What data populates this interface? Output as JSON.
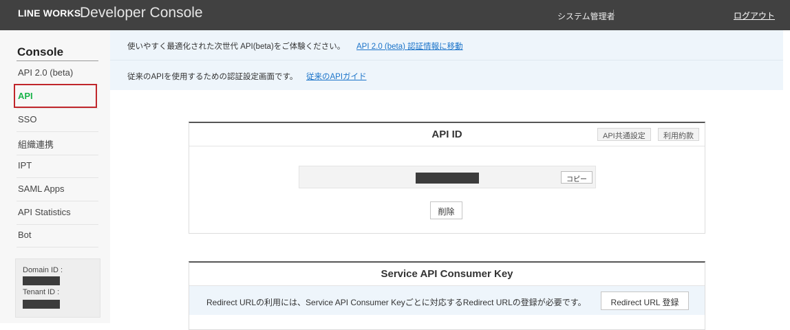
{
  "header": {
    "brand": "LINE WORKS",
    "product": "Developer Console",
    "user_role": "システム管理者",
    "logout_label": "ログアウト"
  },
  "sidebar": {
    "title": "Console",
    "items": [
      {
        "label": "API 2.0 (beta)"
      },
      {
        "label": "API",
        "active": true
      },
      {
        "label": "SSO"
      },
      {
        "label": "組織連携"
      },
      {
        "label": "IPT"
      },
      {
        "label": "SAML Apps"
      },
      {
        "label": "API Statistics"
      },
      {
        "label": "Bot"
      }
    ],
    "domain_id_label": "Domain ID :",
    "tenant_id_label": "Tenant ID :"
  },
  "notices": [
    {
      "text": "使いやすく最適化された次世代 API(beta)をご体験ください。",
      "link": "API 2.0 (beta) 認証情報に移動"
    },
    {
      "text": "従来のAPIを使用するための認証設定画面です。",
      "link": "従来のAPIガイド"
    }
  ],
  "api_id_panel": {
    "title": "API ID",
    "common_settings_label": "API共通設定",
    "terms_label": "利用約款",
    "copy_label": "コピー",
    "delete_label": "削除"
  },
  "consumer_key_panel": {
    "title": "Service API Consumer Key",
    "note": "Redirect URLの利用には、Service API Consumer Keyごとに対応するRedirect URLの登録が必要です。",
    "redirect_button_label": "Redirect URL 登録"
  },
  "colors": {
    "topbar": "#414141",
    "active_nav": "#19b44a",
    "highlight_box": "#c0252a",
    "link": "#1a73c9",
    "notice_bg": "#eef5fb"
  }
}
